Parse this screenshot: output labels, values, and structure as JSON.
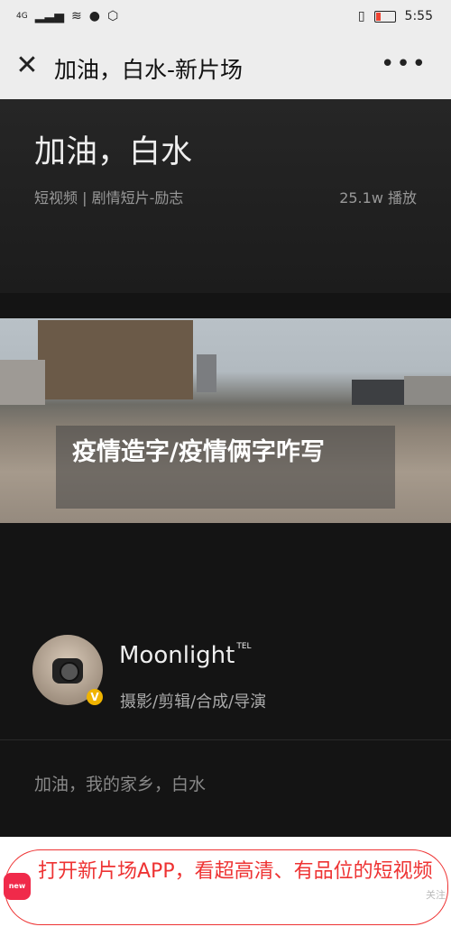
{
  "status": {
    "carrier": "4G",
    "time": "5:55"
  },
  "nav": {
    "title": "加油，白水-新片场"
  },
  "video": {
    "title": "加油，白水",
    "category": "短视频 | 剧情短片-励志",
    "plays": "25.1w 播放",
    "overlay_title": "疫情造字/疫情俩字咋写"
  },
  "author": {
    "name": "Moonlight",
    "name_sup": "TEL",
    "badge": "V",
    "role": "摄影/剪辑/合成/导演"
  },
  "description": "加油，我的家乡，白水",
  "banner": {
    "text": "打开新片场APP，看超高清、有品位的短视频",
    "logo": "new",
    "brand": "关注"
  }
}
